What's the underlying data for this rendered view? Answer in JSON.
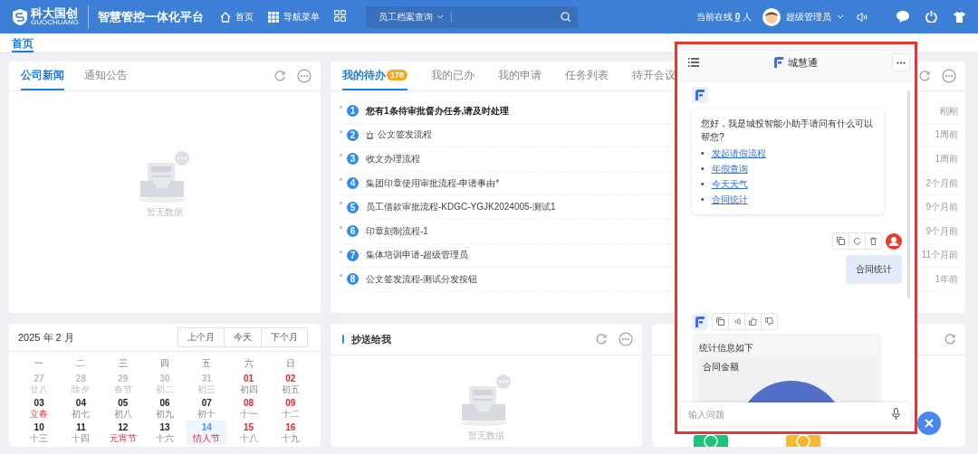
{
  "header": {
    "logo_text": "科大国创",
    "logo_subtext": "GUOCHUANG",
    "platform_title": "智慧管控一体化平台",
    "nav": [
      {
        "label": "首页",
        "kind": "home"
      },
      {
        "label": "导航菜单",
        "kind": "grid"
      }
    ],
    "search": {
      "dropdown": "员工档案查询"
    },
    "online": {
      "label": "当前在线",
      "count": "0",
      "unit": "人"
    },
    "user": {
      "name": "超级管理员"
    }
  },
  "page_tabs": [
    {
      "label": "首页",
      "selected": true
    }
  ],
  "news_card": {
    "tabs": [
      {
        "label": "公司新闻",
        "selected": true
      },
      {
        "label": "通知公告",
        "selected": false
      }
    ],
    "empty_text": "暂无数据"
  },
  "todo_card": {
    "tabs": [
      {
        "label": "我的待办",
        "selected": true,
        "badge": "178"
      },
      {
        "label": "我的已办",
        "selected": false
      },
      {
        "label": "我的申请",
        "selected": false
      },
      {
        "label": "任务列表",
        "selected": false
      },
      {
        "label": "待开会议",
        "selected": false
      }
    ],
    "items": [
      {
        "number": "1",
        "title": "您有1条待审批督办任务,请及时处理",
        "emphasized": true,
        "alarm": false,
        "time": "刚刚"
      },
      {
        "number": "2",
        "title": "公文签发流程",
        "emphasized": false,
        "alarm": true,
        "time": "1周前"
      },
      {
        "number": "3",
        "title": "收文办理流程",
        "emphasized": false,
        "alarm": false,
        "time": "1周前"
      },
      {
        "number": "4",
        "title": "集团印章使用审批流程-申请事由*",
        "emphasized": false,
        "alarm": false,
        "time": "2个月前"
      },
      {
        "number": "5",
        "title": "员工借款审批流程-KDGC-YGJK2024005-测试1",
        "emphasized": false,
        "alarm": false,
        "time": "9个月前"
      },
      {
        "number": "6",
        "title": "印章刻制流程-1",
        "emphasized": false,
        "alarm": false,
        "time": "9个月前"
      },
      {
        "number": "7",
        "title": "集体培训申请-超级管理员",
        "emphasized": false,
        "alarm": false,
        "time": "11个月前"
      },
      {
        "number": "8",
        "title": "公文签发流程-测试分发按钮",
        "emphasized": false,
        "alarm": false,
        "time": "1年前"
      }
    ]
  },
  "calendar": {
    "title": "2025 年 2 月",
    "buttons": [
      "上个月",
      "今天",
      "下个月"
    ],
    "weekdays": [
      "一",
      "二",
      "三",
      "四",
      "五",
      "六",
      "日"
    ],
    "days": [
      {
        "day": "27",
        "lunar": "廿八",
        "kind": "other",
        "festival": false,
        "selected": false
      },
      {
        "day": "28",
        "lunar": "除夕",
        "kind": "other",
        "festival": false,
        "selected": false
      },
      {
        "day": "29",
        "lunar": "春节",
        "kind": "other",
        "festival": false,
        "selected": false
      },
      {
        "day": "30",
        "lunar": "初二",
        "kind": "other",
        "festival": false,
        "selected": false
      },
      {
        "day": "31",
        "lunar": "初三",
        "kind": "other",
        "festival": false,
        "selected": false
      },
      {
        "day": "01",
        "lunar": "初四",
        "kind": "weekend",
        "festival": false,
        "selected": false
      },
      {
        "day": "02",
        "lunar": "初五",
        "kind": "weekend",
        "festival": false,
        "selected": false
      },
      {
        "day": "03",
        "lunar": "立春",
        "kind": "weekday",
        "festival": true,
        "selected": false
      },
      {
        "day": "04",
        "lunar": "初七",
        "kind": "weekday",
        "festival": false,
        "selected": false
      },
      {
        "day": "05",
        "lunar": "初八",
        "kind": "weekday",
        "festival": false,
        "selected": false
      },
      {
        "day": "06",
        "lunar": "初九",
        "kind": "weekday",
        "festival": false,
        "selected": false
      },
      {
        "day": "07",
        "lunar": "初十",
        "kind": "weekday",
        "festival": false,
        "selected": false
      },
      {
        "day": "08",
        "lunar": "十一",
        "kind": "weekend",
        "festival": false,
        "selected": false
      },
      {
        "day": "09",
        "lunar": "十二",
        "kind": "weekend",
        "festival": false,
        "selected": false
      },
      {
        "day": "10",
        "lunar": "十三",
        "kind": "weekday",
        "festival": false,
        "selected": false
      },
      {
        "day": "11",
        "lunar": "十四",
        "kind": "weekday",
        "festival": false,
        "selected": false
      },
      {
        "day": "12",
        "lunar": "元宵节",
        "kind": "weekday",
        "festival": true,
        "selected": false
      },
      {
        "day": "13",
        "lunar": "十六",
        "kind": "weekday",
        "festival": false,
        "selected": false
      },
      {
        "day": "14",
        "lunar": "情人节",
        "kind": "weekday",
        "festival": true,
        "selected": true
      },
      {
        "day": "15",
        "lunar": "十八",
        "kind": "weekend",
        "festival": false,
        "selected": false
      },
      {
        "day": "16",
        "lunar": "十九",
        "kind": "weekend",
        "festival": false,
        "selected": false
      }
    ]
  },
  "cc_card": {
    "title": "抄送给我",
    "empty_text": "暂无数据"
  },
  "chat": {
    "title": "城慧通",
    "messages": [
      {
        "kind": "bot",
        "text": "您好，我是城投智能小助手请问有什么可以帮您?",
        "bullet": "•",
        "links": [
          "发起请假流程",
          "年假查询",
          "今天天气",
          "合同统计"
        ]
      },
      {
        "kind": "user",
        "text": "合同统计"
      },
      {
        "kind": "bot-chart",
        "text": "统计信息如下",
        "chart_title": "合同金额"
      }
    ],
    "input": {
      "placeholder": "输入问题"
    }
  }
}
